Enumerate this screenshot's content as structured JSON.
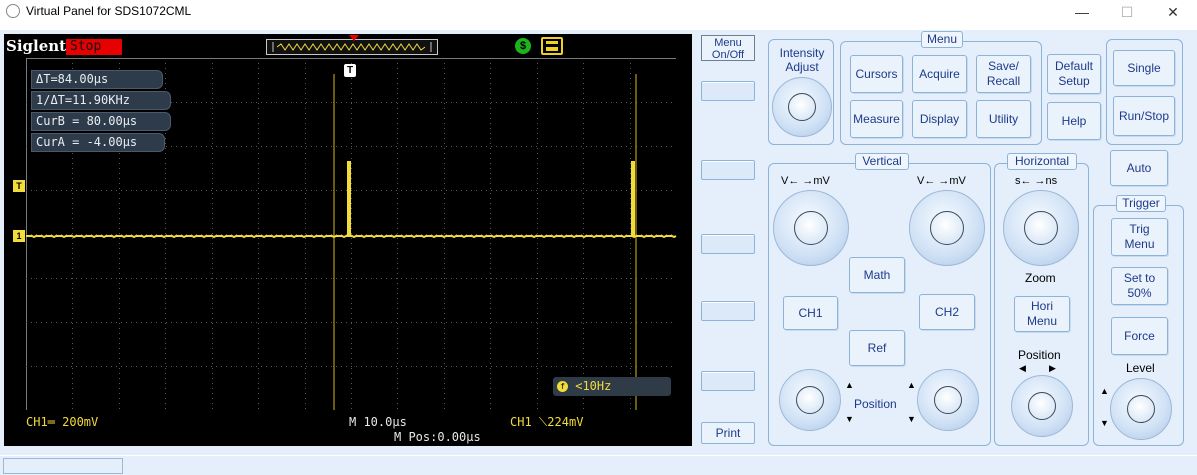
{
  "window": {
    "title": "Virtual Panel for SDS1072CML",
    "minimize": "—",
    "maximize": "☐",
    "close": "✕"
  },
  "scope": {
    "brand": "Siglent",
    "run_state": "Stop",
    "status_colors": {
      "stop": "#e60000",
      "trace": "#f2dc3a",
      "usb": "#1db31d"
    },
    "cursors": {
      "delta_t": "ΔT=84.00µs",
      "inv_delta_t": "1/ΔT=11.90KHz",
      "cur_b": "CurB = 80.00µs",
      "cur_a": "CurA = -4.00µs"
    },
    "markers": {
      "trigger_level": "T",
      "channel1": "1",
      "trigger_pos": "T"
    },
    "freq_counter": "<10Hz",
    "ch1_scale": "CH1═ 200mV",
    "timebase": "M 10.0µs",
    "m_pos": "M Pos:0.00µs",
    "trigger_info": "CH1 ⟍224mV"
  },
  "softkeys": {
    "menu_on_off": [
      "Menu",
      "On/Off"
    ],
    "print": "Print"
  },
  "panel": {
    "intensity": [
      "Intensity",
      "Adjust"
    ],
    "menu": {
      "title": "Menu",
      "cursors": "Cursors",
      "acquire": "Acquire",
      "save_recall": [
        "Save/",
        "Recall"
      ],
      "measure": "Measure",
      "display": "Display",
      "utility": "Utility"
    },
    "default_setup": [
      "Default",
      "Setup"
    ],
    "help": "Help",
    "single": "Single",
    "run_stop": "Run/Stop",
    "auto": "Auto",
    "vertical": {
      "title": "Vertical",
      "volts_label_left": "V← →mV",
      "volts_label_right": "V← →mV",
      "math": "Math",
      "ch1": "CH1",
      "ch2": "CH2",
      "ref": "Ref",
      "position": "Position"
    },
    "horizontal": {
      "title": "Horizontal",
      "time_label": "s← →ns",
      "zoom": "Zoom",
      "hori_menu": [
        "Hori",
        "Menu"
      ],
      "position": "Position"
    },
    "trigger": {
      "title": "Trigger",
      "trig_menu": [
        "Trig",
        "Menu"
      ],
      "set_50": [
        "Set to",
        "50%"
      ],
      "force": "Force",
      "level": "Level"
    }
  }
}
